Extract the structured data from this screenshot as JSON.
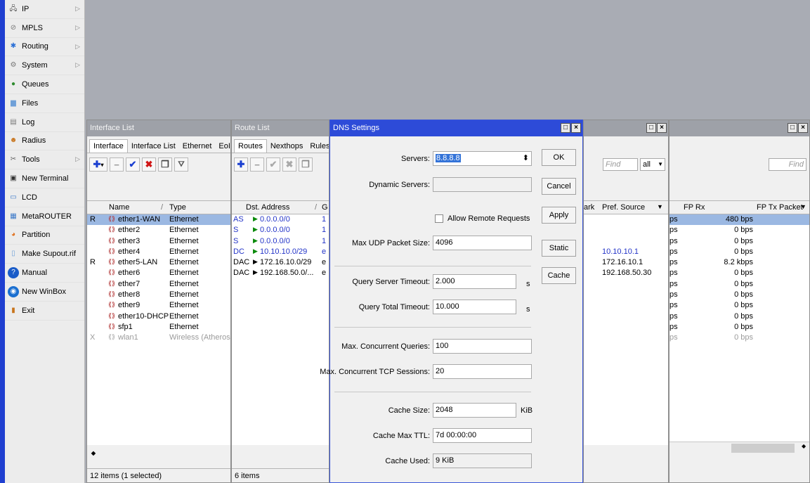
{
  "sidebar": {
    "items": [
      {
        "label": "IP",
        "icon": "ip-icon",
        "arrow": true
      },
      {
        "label": "MPLS",
        "icon": "mpls-icon",
        "arrow": true
      },
      {
        "label": "Routing",
        "icon": "routing-icon",
        "arrow": true
      },
      {
        "label": "System",
        "icon": "gear-icon",
        "arrow": true
      },
      {
        "label": "Queues",
        "icon": "queues-icon",
        "arrow": false
      },
      {
        "label": "Files",
        "icon": "folder-icon",
        "arrow": false
      },
      {
        "label": "Log",
        "icon": "document-icon",
        "arrow": false
      },
      {
        "label": "Radius",
        "icon": "users-icon",
        "arrow": false
      },
      {
        "label": "Tools",
        "icon": "tools-icon",
        "arrow": true
      },
      {
        "label": "New Terminal",
        "icon": "terminal-icon",
        "arrow": false
      },
      {
        "label": "LCD",
        "icon": "monitor-icon",
        "arrow": false
      },
      {
        "label": "MetaROUTER",
        "icon": "network-icon",
        "arrow": false
      },
      {
        "label": "Partition",
        "icon": "pie-chart-icon",
        "arrow": false
      },
      {
        "label": "Make Supout.rif",
        "icon": "file-icon",
        "arrow": false
      },
      {
        "label": "Manual",
        "icon": "help-icon",
        "arrow": false
      },
      {
        "label": "New WinBox",
        "icon": "winbox-icon",
        "arrow": false
      },
      {
        "label": "Exit",
        "icon": "exit-icon",
        "arrow": false
      }
    ]
  },
  "interface_list": {
    "title": "Interface List",
    "tabs": [
      "Interface",
      "Interface List",
      "Ethernet",
      "EoIP Tu"
    ],
    "columns": {
      "name": "Name",
      "type": "Type"
    },
    "rows": [
      {
        "flag": "R",
        "name": "ether1-WAN",
        "type": "Ethernet",
        "selected": true
      },
      {
        "flag": "",
        "name": "ether2",
        "type": "Ethernet"
      },
      {
        "flag": "",
        "name": "ether3",
        "type": "Ethernet"
      },
      {
        "flag": "",
        "name": "ether4",
        "type": "Ethernet"
      },
      {
        "flag": "R",
        "name": "ether5-LAN",
        "type": "Ethernet"
      },
      {
        "flag": "",
        "name": "ether6",
        "type": "Ethernet"
      },
      {
        "flag": "",
        "name": "ether7",
        "type": "Ethernet"
      },
      {
        "flag": "",
        "name": "ether8",
        "type": "Ethernet"
      },
      {
        "flag": "",
        "name": "ether9",
        "type": "Ethernet"
      },
      {
        "flag": "",
        "name": "ether10-DHCP",
        "type": "Ethernet"
      },
      {
        "flag": "",
        "name": "sfp1",
        "type": "Ethernet"
      },
      {
        "flag": "X",
        "name": "wlan1",
        "type": "Wireless (Atheros A",
        "disabled": true
      }
    ],
    "status": "12 items (1 selected)"
  },
  "route_list": {
    "title": "Route List",
    "tabs": [
      "Routes",
      "Nexthops",
      "Rules"
    ],
    "columns": {
      "dst": "Dst. Address",
      "g": "G"
    },
    "rows": [
      {
        "flag": "AS",
        "dst": "0.0.0.0/0",
        "g": "1",
        "blue": true
      },
      {
        "flag": "S",
        "dst": "0.0.0.0/0",
        "g": "1",
        "blue": true
      },
      {
        "flag": "S",
        "dst": "0.0.0.0/0",
        "g": "1",
        "blue": true
      },
      {
        "flag": "DC",
        "dst": "10.10.10.0/29",
        "g": "e",
        "blue": true
      },
      {
        "flag": "DAC",
        "dst": "172.16.10.0/29",
        "g": "e",
        "blue": false
      },
      {
        "flag": "DAC",
        "dst": "192.168.50.0/...",
        "g": "e",
        "blue": false
      }
    ],
    "status": "6 items"
  },
  "address_window": {
    "find_placeholder": "Find",
    "filter_value": "all",
    "columns": {
      "rk": "ark",
      "pref": "Pref. Source"
    },
    "pref_sources": [
      "",
      "",
      "",
      "10.10.10.1",
      "172.16.10.1",
      "192.168.50.30"
    ]
  },
  "traffic_window": {
    "find_placeholder": "Find",
    "columns": {
      "fp_rx": "FP Rx",
      "fp_tx": "FP Tx Packet"
    },
    "rows": [
      {
        "bps": "ps",
        "fp_rx": "480 bps",
        "selected": true
      },
      {
        "bps": "ps",
        "fp_rx": "0 bps"
      },
      {
        "bps": "ps",
        "fp_rx": "0 bps"
      },
      {
        "bps": "ps",
        "fp_rx": "0 bps"
      },
      {
        "bps": "ps",
        "fp_rx": "8.2 kbps"
      },
      {
        "bps": "ps",
        "fp_rx": "0 bps"
      },
      {
        "bps": "ps",
        "fp_rx": "0 bps"
      },
      {
        "bps": "ps",
        "fp_rx": "0 bps"
      },
      {
        "bps": "ps",
        "fp_rx": "0 bps"
      },
      {
        "bps": "ps",
        "fp_rx": "0 bps"
      },
      {
        "bps": "ps",
        "fp_rx": "0 bps"
      },
      {
        "bps": "ps",
        "fp_rx": "0 bps",
        "disabled": true
      }
    ]
  },
  "dns": {
    "title": "DNS Settings",
    "labels": {
      "servers": "Servers:",
      "dynamic_servers": "Dynamic Servers:",
      "allow_remote": "Allow Remote Requests",
      "max_udp": "Max UDP Packet Size:",
      "query_server_timeout": "Query Server Timeout:",
      "query_total_timeout": "Query Total Timeout:",
      "max_concurrent_queries": "Max. Concurrent Queries:",
      "max_concurrent_tcp": "Max. Concurrent TCP Sessions:",
      "cache_size": "Cache Size:",
      "cache_max_ttl": "Cache Max TTL:",
      "cache_used": "Cache Used:"
    },
    "values": {
      "servers": "8.8.8.8",
      "dynamic_servers": "",
      "max_udp": "4096",
      "query_server_timeout": "2.000",
      "query_total_timeout": "10.000",
      "max_concurrent_queries": "100",
      "max_concurrent_tcp": "20",
      "cache_size": "2048",
      "cache_max_ttl": "7d 00:00:00",
      "cache_used": "9 KiB"
    },
    "units": {
      "seconds": "s",
      "kib": "KiB"
    },
    "buttons": {
      "ok": "OK",
      "cancel": "Cancel",
      "apply": "Apply",
      "static": "Static",
      "cache": "Cache"
    }
  }
}
